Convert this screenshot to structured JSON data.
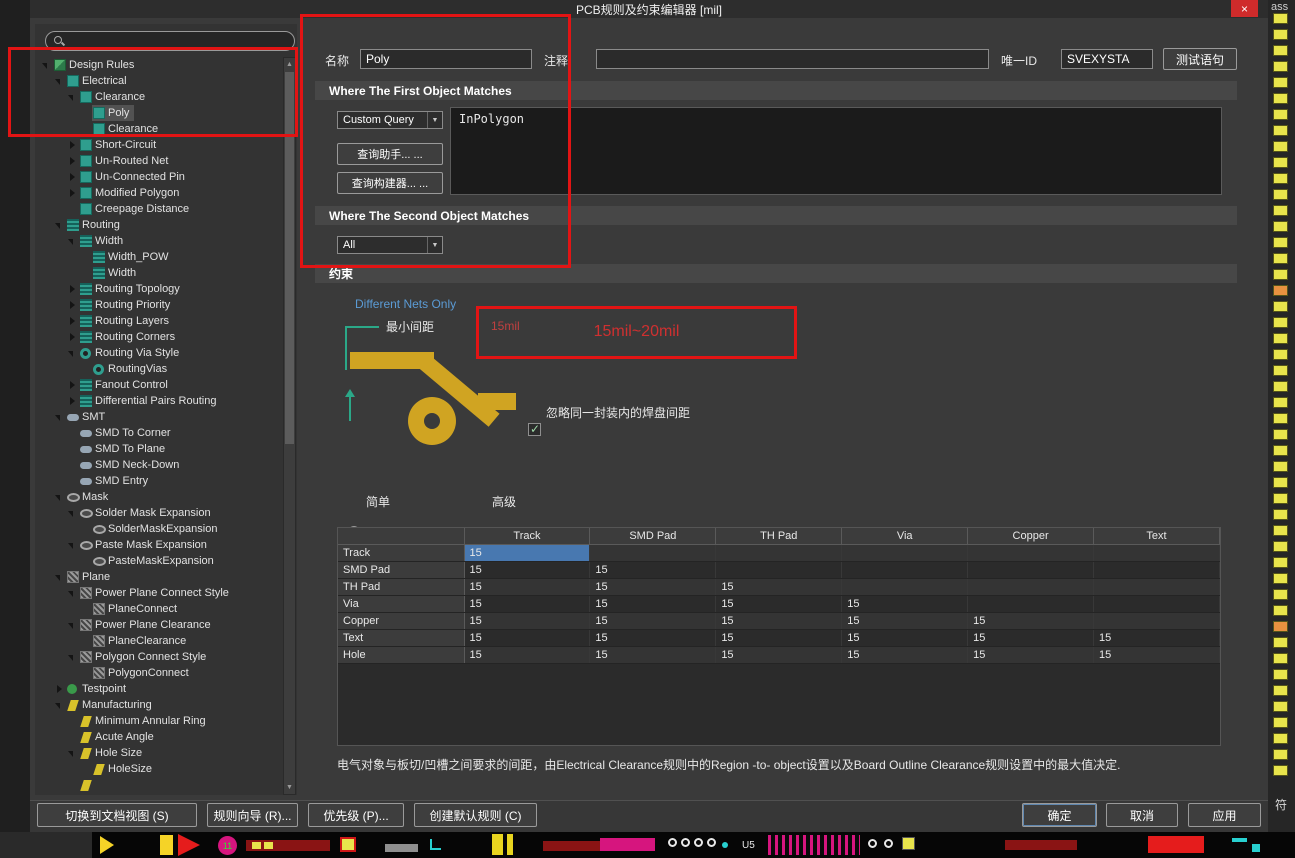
{
  "window": {
    "title": "PCB规则及约束编辑器 [mil]",
    "close_glyph": "×"
  },
  "background": {
    "right_top_text": "ass",
    "right_bottom_text": "符",
    "pcb_label_u5": "U5",
    "pcb_label_11": "11"
  },
  "right_panel": {
    "square_count": 48,
    "orange_indices": [
      17,
      38
    ]
  },
  "sidebar": {
    "tree": [
      {
        "label": "Design Rules",
        "level": 0,
        "expand": "open",
        "icon": "rules"
      },
      {
        "label": "Electrical",
        "level": 1,
        "expand": "open",
        "icon": "teal"
      },
      {
        "label": "Clearance",
        "level": 2,
        "expand": "open",
        "icon": "teal"
      },
      {
        "label": "Poly",
        "level": 3,
        "expand": "none",
        "icon": "teal",
        "selected": true
      },
      {
        "label": "Clearance",
        "level": 3,
        "expand": "none",
        "icon": "teal"
      },
      {
        "label": "Short-Circuit",
        "level": 2,
        "expand": "closed",
        "icon": "teal"
      },
      {
        "label": "Un-Routed Net",
        "level": 2,
        "expand": "closed",
        "icon": "teal"
      },
      {
        "label": "Un-Connected Pin",
        "level": 2,
        "expand": "closed",
        "icon": "teal"
      },
      {
        "label": "Modified Polygon",
        "level": 2,
        "expand": "closed",
        "icon": "teal"
      },
      {
        "label": "Creepage Distance",
        "level": 2,
        "expand": "none",
        "icon": "teal"
      },
      {
        "label": "Routing",
        "level": 1,
        "expand": "open",
        "icon": "width"
      },
      {
        "label": "Width",
        "level": 2,
        "expand": "open",
        "icon": "width"
      },
      {
        "label": "Width_POW",
        "level": 3,
        "expand": "none",
        "icon": "width"
      },
      {
        "label": "Width",
        "level": 3,
        "expand": "none",
        "icon": "width"
      },
      {
        "label": "Routing Topology",
        "level": 2,
        "expand": "closed",
        "icon": "width"
      },
      {
        "label": "Routing Priority",
        "level": 2,
        "expand": "closed",
        "icon": "width"
      },
      {
        "label": "Routing Layers",
        "level": 2,
        "expand": "closed",
        "icon": "width"
      },
      {
        "label": "Routing Corners",
        "level": 2,
        "expand": "closed",
        "icon": "width"
      },
      {
        "label": "Routing Via Style",
        "level": 2,
        "expand": "open",
        "icon": "via"
      },
      {
        "label": "RoutingVias",
        "level": 3,
        "expand": "none",
        "icon": "via"
      },
      {
        "label": "Fanout Control",
        "level": 2,
        "expand": "closed",
        "icon": "width"
      },
      {
        "label": "Differential Pairs Routing",
        "level": 2,
        "expand": "closed",
        "icon": "width"
      },
      {
        "label": "SMT",
        "level": 1,
        "expand": "open",
        "icon": "smd"
      },
      {
        "label": "SMD To Corner",
        "level": 2,
        "expand": "none",
        "icon": "smd"
      },
      {
        "label": "SMD To Plane",
        "level": 2,
        "expand": "none",
        "icon": "smd"
      },
      {
        "label": "SMD Neck-Down",
        "level": 2,
        "expand": "none",
        "icon": "smd"
      },
      {
        "label": "SMD Entry",
        "level": 2,
        "expand": "none",
        "icon": "smd"
      },
      {
        "label": "Mask",
        "level": 1,
        "expand": "open",
        "icon": "mask"
      },
      {
        "label": "Solder Mask Expansion",
        "level": 2,
        "expand": "open",
        "icon": "mask"
      },
      {
        "label": "SolderMaskExpansion",
        "level": 3,
        "expand": "none",
        "icon": "mask"
      },
      {
        "label": "Paste Mask Expansion",
        "level": 2,
        "expand": "open",
        "icon": "mask"
      },
      {
        "label": "PasteMaskExpansion",
        "level": 3,
        "expand": "none",
        "icon": "mask"
      },
      {
        "label": "Plane",
        "level": 1,
        "expand": "open",
        "icon": "plane"
      },
      {
        "label": "Power Plane Connect Style",
        "level": 2,
        "expand": "open",
        "icon": "plane"
      },
      {
        "label": "PlaneConnect",
        "level": 3,
        "expand": "none",
        "icon": "plane"
      },
      {
        "label": "Power Plane Clearance",
        "level": 2,
        "expand": "open",
        "icon": "plane"
      },
      {
        "label": "PlaneClearance",
        "level": 3,
        "expand": "none",
        "icon": "plane"
      },
      {
        "label": "Polygon Connect Style",
        "level": 2,
        "expand": "open",
        "icon": "plane"
      },
      {
        "label": "PolygonConnect",
        "level": 3,
        "expand": "none",
        "icon": "plane"
      },
      {
        "label": "Testpoint",
        "level": 1,
        "expand": "closed",
        "icon": "testpoint"
      },
      {
        "label": "Manufacturing",
        "level": 1,
        "expand": "open",
        "icon": "manuf"
      },
      {
        "label": "Minimum Annular Ring",
        "level": 2,
        "expand": "none",
        "icon": "manuf"
      },
      {
        "label": "Acute Angle",
        "level": 2,
        "expand": "none",
        "icon": "manuf"
      },
      {
        "label": "Hole Size",
        "level": 2,
        "expand": "open",
        "icon": "manuf"
      },
      {
        "label": "HoleSize",
        "level": 3,
        "expand": "none",
        "icon": "manuf"
      },
      {
        "label": "",
        "level": 2,
        "expand": "none",
        "icon": "manuf"
      }
    ]
  },
  "form": {
    "name_label": "名称",
    "name_value": "Poly",
    "comment_label": "注释",
    "comment_value": "",
    "unique_id_label": "唯一ID",
    "unique_id_value": "SVEXYSTA",
    "test_query_button": "测试语句",
    "first_match_header": "Where The First Object Matches",
    "first_match_selected": "Custom Query",
    "query_text": "InPolygon",
    "query_helper_button": "查询助手... ...",
    "query_builder_button": "查询构建器... ...",
    "second_match_header": "Where The Second Object Matches",
    "second_match_selected": "All"
  },
  "constraints": {
    "header": "约束",
    "different_nets_label": "Different Nets Only",
    "min_clearance_label": "最小间距",
    "clearance_value": "15mil",
    "ignore_pads_label": "忽略同一封装内的焊盘间距",
    "ignore_pads_checked": true,
    "mode_simple": "简单",
    "mode_advanced": "高级",
    "table": {
      "columns": [
        "",
        "Track",
        "SMD Pad",
        "TH Pad",
        "Via",
        "Copper",
        "Text"
      ],
      "rows": [
        {
          "label": "Track",
          "values": [
            "15",
            "",
            "",
            "",
            "",
            ""
          ],
          "highlight": 0
        },
        {
          "label": "SMD Pad",
          "values": [
            "15",
            "15",
            "",
            "",
            "",
            ""
          ]
        },
        {
          "label": "TH Pad",
          "values": [
            "15",
            "15",
            "15",
            "",
            "",
            ""
          ]
        },
        {
          "label": "Via",
          "values": [
            "15",
            "15",
            "15",
            "15",
            "",
            ""
          ]
        },
        {
          "label": "Copper",
          "values": [
            "15",
            "15",
            "15",
            "15",
            "15",
            ""
          ]
        },
        {
          "label": "Text",
          "values": [
            "15",
            "15",
            "15",
            "15",
            "15",
            "15"
          ]
        },
        {
          "label": "Hole",
          "values": [
            "15",
            "15",
            "15",
            "15",
            "15",
            "15"
          ]
        }
      ]
    },
    "note": "电气对象与板切/凹槽之间要求的间距，由Electrical Clearance规则中的Region -to- object设置以及Board Outline Clearance规则设置中的最大值决定."
  },
  "annotations": {
    "range_text": "15mil~20mil"
  },
  "footer": {
    "switch_view": "切换到文档视图 (S)",
    "wizard": "规则向导 (R)...",
    "priority": "优先级 (P)...",
    "create_default": "创建默认规则 (C)",
    "ok": "确定",
    "cancel": "取消",
    "apply": "应用"
  }
}
